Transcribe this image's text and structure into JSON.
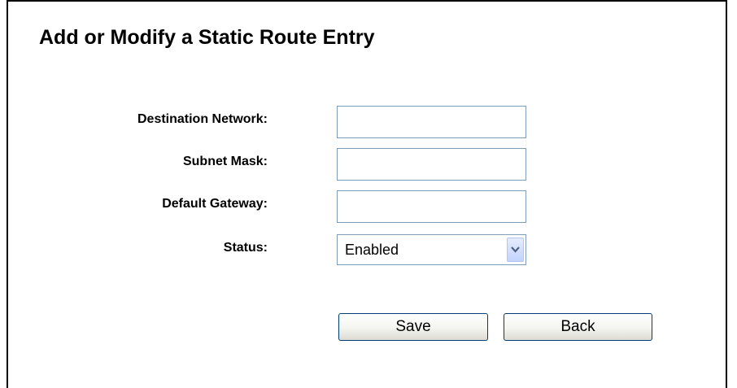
{
  "page": {
    "title": "Add or Modify a Static Route Entry"
  },
  "form": {
    "destination_network": {
      "label": "Destination Network:",
      "value": ""
    },
    "subnet_mask": {
      "label": "Subnet Mask:",
      "value": ""
    },
    "default_gateway": {
      "label": "Default Gateway:",
      "value": ""
    },
    "status": {
      "label": "Status:",
      "selected": "Enabled"
    }
  },
  "buttons": {
    "save_label": "Save",
    "back_label": "Back"
  },
  "icons": {
    "dropdown": "chevron-down-icon"
  },
  "colors": {
    "input_border": "#7f9db9",
    "button_border": "#003c74",
    "frame_border": "#000000"
  }
}
